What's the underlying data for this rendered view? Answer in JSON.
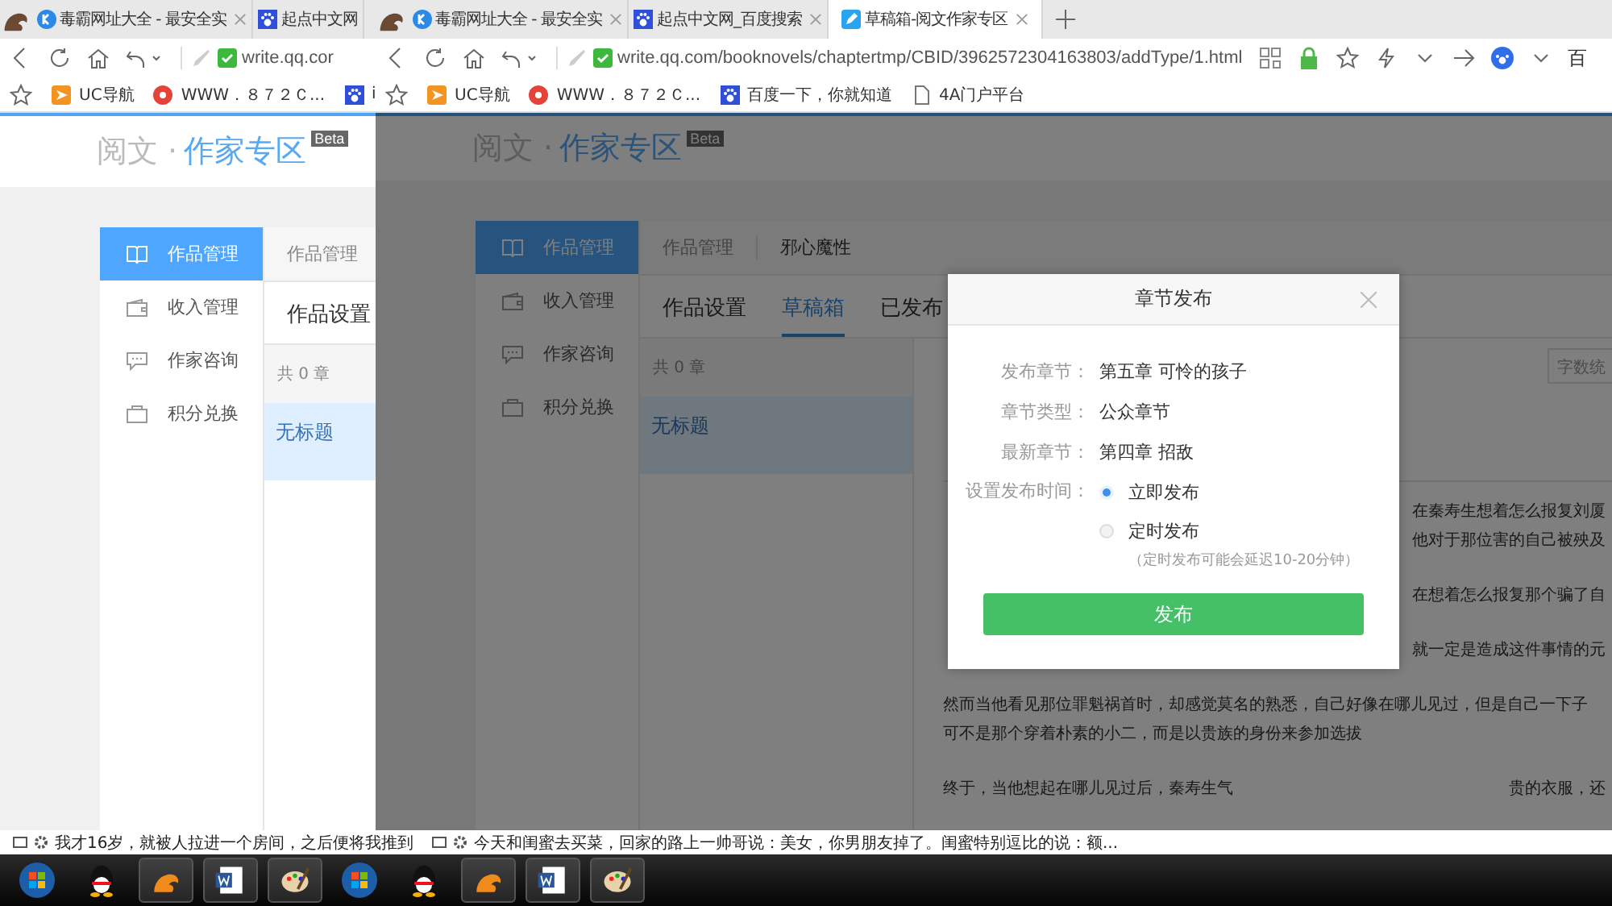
{
  "windows": [
    {
      "tabs": [
        {
          "title": "毒霸网址大全 - 最安全实",
          "selected": false
        },
        {
          "title": "起点中文网",
          "selected": false
        }
      ],
      "url": "write.qq.cor",
      "bookmarks": [
        {
          "label": "UC导航"
        },
        {
          "label": "WWW．８７２Ｃ..."
        },
        {
          "label": "i"
        }
      ],
      "page": {
        "brand_a": "阅文 ·",
        "brand_b": "作家专区",
        "badge": "Beta",
        "menu": [
          {
            "label": "作品管理",
            "selected": true
          },
          {
            "label": "收入管理",
            "selected": false
          },
          {
            "label": "作家咨询",
            "selected": false
          },
          {
            "label": "积分兑换",
            "selected": false
          }
        ],
        "breadcrumb": [
          "作品管理"
        ],
        "tabs": [
          {
            "label": "作品设置",
            "selected": false
          }
        ],
        "chapter_count": "共 0 章",
        "chapters": [
          {
            "title": "无标题",
            "selected": true
          }
        ]
      }
    },
    {
      "tabs": [
        {
          "title": "毒霸网址大全 - 最安全实",
          "selected": false
        },
        {
          "title": "起点中文网_百度搜索",
          "selected": false
        },
        {
          "title": "草稿箱-阅文作家专区",
          "selected": true
        }
      ],
      "url": "write.qq.com/booknovels/chaptertmp/CBID/3962572304163803/addType/1.html",
      "search_engine": "百",
      "bookmarks": [
        {
          "label": "UC导航"
        },
        {
          "label": "WWW．８７２Ｃ..."
        },
        {
          "label": "百度一下，你就知道"
        },
        {
          "label": "4A门户平台"
        }
      ],
      "page": {
        "brand_a": "阅文 ·",
        "brand_b": "作家专区",
        "badge": "Beta",
        "menu": [
          {
            "label": "作品管理",
            "selected": true
          },
          {
            "label": "收入管理",
            "selected": false
          },
          {
            "label": "作家咨询",
            "selected": false
          },
          {
            "label": "积分兑换",
            "selected": false
          }
        ],
        "breadcrumb": [
          "作品管理",
          "邪心魔性"
        ],
        "tabs": [
          {
            "label": "作品设置",
            "selected": false
          },
          {
            "label": "草稿箱",
            "selected": true
          },
          {
            "label": "已发布",
            "selected": false
          }
        ],
        "chapter_count": "共 0 章",
        "chapters": [
          {
            "title": "无标题",
            "selected": true
          }
        ],
        "article": {
          "search_placeholder": "字数统",
          "paragraphs": [
            [
              {
                "end": "在秦寿生想着怎么报复刘厦"
              },
              {
                "end": "他对于那位害的自己被殃及"
              }
            ],
            [
              {
                "end": "在想着怎么报复那个骗了自"
              }
            ],
            [
              {
                "end": "就一定是造成这件事情的元"
              }
            ],
            [
              {
                "start": "然而当他看见那位罪魁祸首时，却感觉莫名的熟悉，自己好像在哪儿见过，但是自己一下子"
              },
              {
                "start": "可不是那个穿着朴素的小二，而是以贵族的身份来参加选拔"
              }
            ],
            [
              {
                "start": "终于，当他想起在哪儿见过后，秦寿生气",
                "end": "贵的衣服，还"
              }
            ]
          ]
        },
        "dialog": {
          "title": "章节发布",
          "fields": [
            {
              "label": "发布章节：",
              "value": "第五章 可怜的孩子"
            },
            {
              "label": "章节类型：",
              "value": "公众章节"
            },
            {
              "label": "最新章节：",
              "value": "第四章 招敌"
            }
          ],
          "time_label": "设置发布时间：",
          "options": [
            {
              "label": "立即发布",
              "selected": true
            },
            {
              "label": "定时发布",
              "selected": false
            }
          ],
          "note": "（定时发布可能会延迟10-20分钟）",
          "button": "发布"
        }
      }
    }
  ],
  "status_bar": [
    "我才16岁，就被人拉进一个房间，之后便将我推到",
    "今天和闺蜜去买菜，回家的路上一帅哥说：美女，你男朋友掉了。闺蜜特别逗比的说：额..."
  ],
  "taskbar": [
    {
      "kind": "start"
    },
    {
      "kind": "qq"
    },
    {
      "kind": "uc"
    },
    {
      "kind": "word"
    },
    {
      "kind": "paint"
    },
    {
      "kind": "start"
    },
    {
      "kind": "qq"
    },
    {
      "kind": "uc"
    },
    {
      "kind": "word"
    },
    {
      "kind": "paint"
    }
  ]
}
